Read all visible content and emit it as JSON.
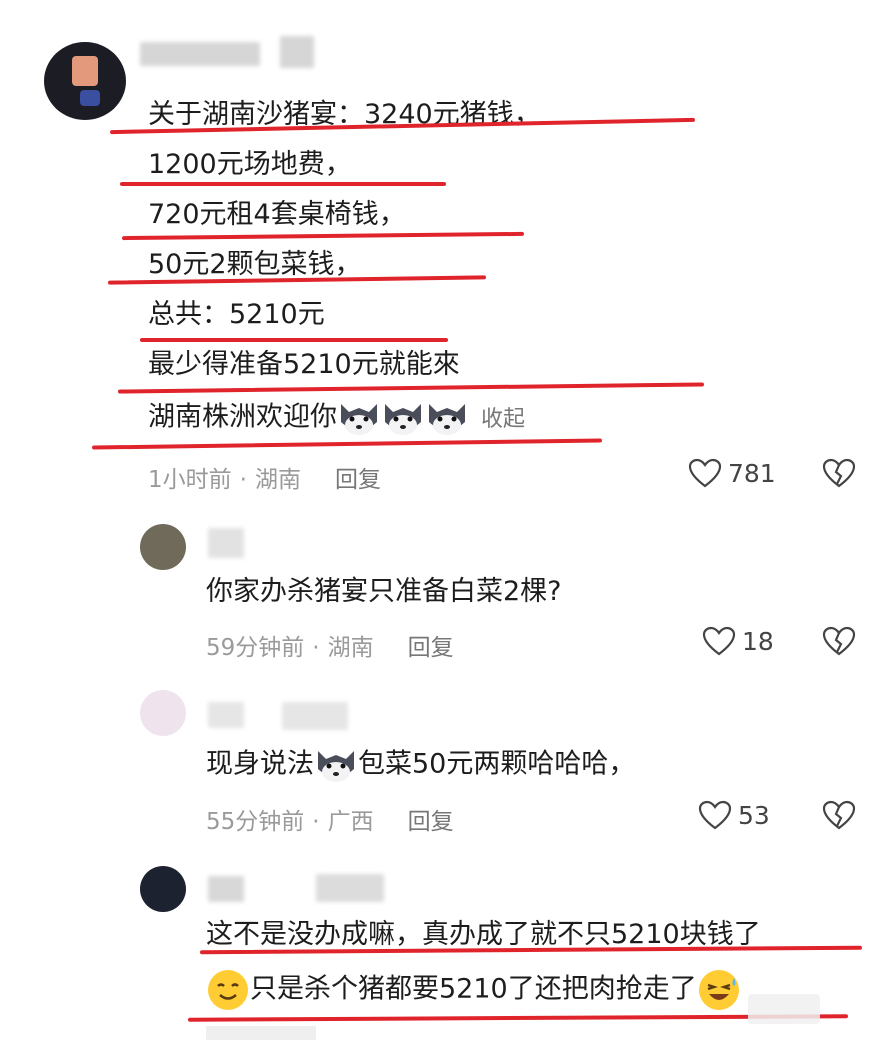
{
  "main_comment": {
    "lines": [
      "关于湖南沙猪宴：3240元猪钱，",
      "1200元场地费，",
      "720元租4套桌椅钱，",
      "50元2颗包菜钱，",
      "总共：5210元",
      "最少得准备5210元就能來",
      "湖南株洲欢迎你"
    ],
    "fold_label": "收起",
    "time": "1小时前",
    "location": "湖南",
    "reply_label": "回复",
    "likes": "781"
  },
  "replies": [
    {
      "text": "你家办杀猪宴只准备白菜2棵?",
      "time": "59分钟前",
      "location": "湖南",
      "reply_label": "回复",
      "likes": "18"
    },
    {
      "text_before": "现身说法",
      "text_after": "包菜50元两颗哈哈哈，",
      "time": "55分钟前",
      "location": "广西",
      "reply_label": "回复",
      "likes": "53"
    },
    {
      "line1": "这不是没办成嘛，真办成了就不只5210块钱了",
      "line2": "只是杀个猪都要5210了还把肉抢走了"
    }
  ],
  "icons": [
    "heart-icon",
    "broken-heart-icon",
    "husky-emoji-icon",
    "smile-emoji-icon",
    "laugh-cry-emoji-icon"
  ],
  "colors": {
    "underline": "#e0242b",
    "meta": "#9a9a9a",
    "text": "#1d1d1d"
  }
}
